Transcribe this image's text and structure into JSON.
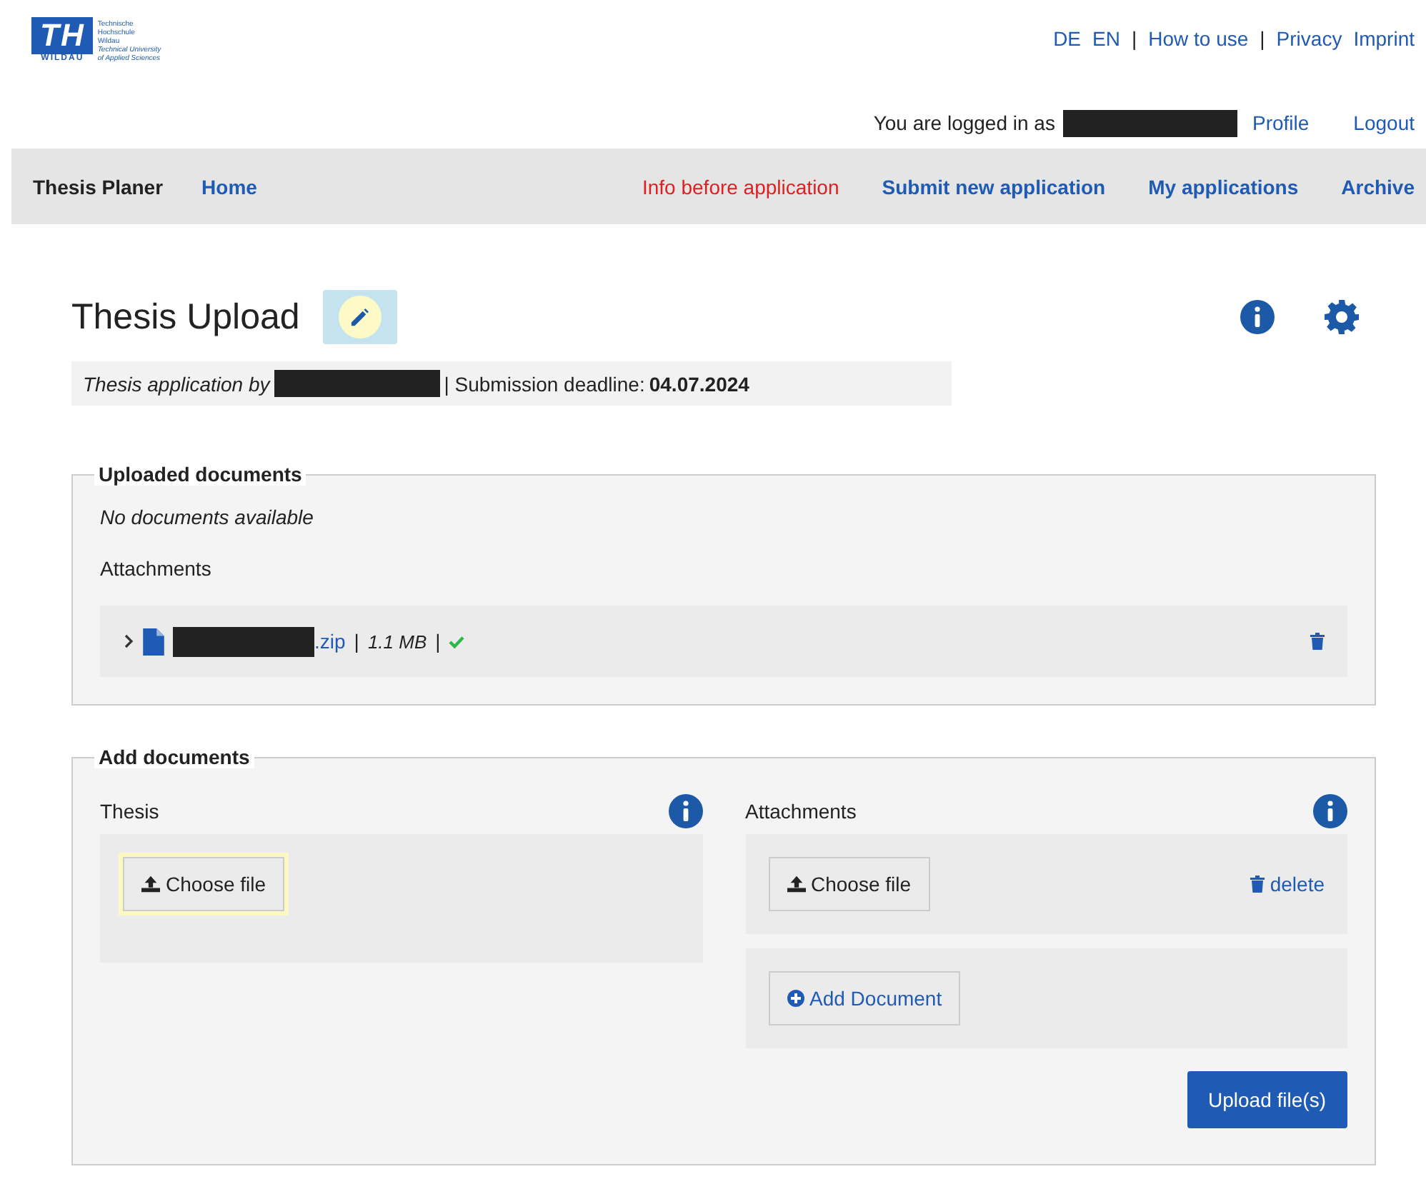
{
  "logo": {
    "mark": "TH",
    "wordmark": "WILDAU",
    "lines": [
      "Technische",
      "Hochschule",
      "Wildau"
    ],
    "lines_en": [
      "Technical University",
      "of Applied Sciences"
    ]
  },
  "top_links": [
    {
      "label": "DE",
      "kind": "lang"
    },
    {
      "label": "EN",
      "kind": "lang"
    },
    {
      "label": "|",
      "kind": "sep"
    },
    {
      "label": "How to use",
      "kind": "link"
    },
    {
      "label": "|",
      "kind": "sep"
    },
    {
      "label": "Privacy",
      "kind": "link"
    },
    {
      "label": "Imprint",
      "kind": "link"
    }
  ],
  "user_bar": {
    "text": "You are logged in as",
    "links": [
      "Profile",
      "Logout"
    ]
  },
  "nav": {
    "brand": "Thesis Planer",
    "items": [
      {
        "label": "Home",
        "kind": "link"
      },
      {
        "label": "Info before application",
        "kind": "alert"
      },
      {
        "label": "Submit new application",
        "kind": "link"
      },
      {
        "label": "My applications",
        "kind": "link"
      },
      {
        "label": "Archive",
        "kind": "link"
      }
    ]
  },
  "page": {
    "title": "Thesis Upload",
    "meta_prefix": "Thesis application by",
    "meta_suffix": "| Submission deadline:",
    "deadline": "04.07.2024"
  },
  "uploaded": {
    "legend": "Uploaded documents",
    "empty_text": "No documents available",
    "attachments_label": "Attachments",
    "files": [
      {
        "ext": ".zip",
        "sep1": "|",
        "size": "1.1 MB",
        "sep2": "|",
        "expanded": false,
        "verified": true
      }
    ]
  },
  "add": {
    "legend": "Add documents",
    "thesis": {
      "label": "Thesis",
      "button": "Choose file"
    },
    "attachments": {
      "label": "Attachments",
      "button": "Choose file",
      "delete": "delete",
      "add_button": "Add Document"
    },
    "upload_button": "Upload file(s)"
  }
}
